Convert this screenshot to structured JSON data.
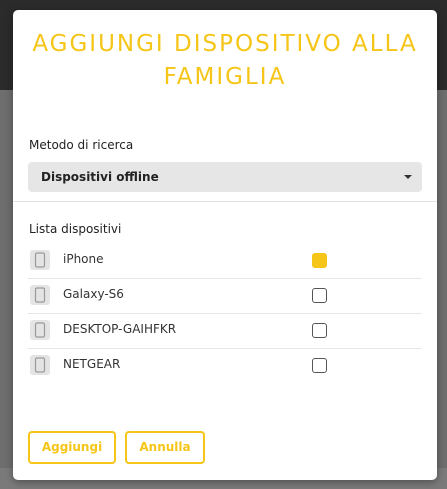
{
  "dialog": {
    "title_line1": "AGGIUNGI DISPOSITIVO ALLA",
    "title_line2": "FAMIGLIA",
    "accent_color": "#f5c518"
  },
  "search": {
    "label": "Metodo di ricerca",
    "selected": "Dispositivi offline"
  },
  "devices": {
    "label": "Lista dispositivi",
    "items": [
      {
        "name": "iPhone",
        "checked": true,
        "icon": "phone-icon"
      },
      {
        "name": "Galaxy-S6",
        "checked": false,
        "icon": "phone-icon"
      },
      {
        "name": "DESKTOP-GAIHFKR",
        "checked": false,
        "icon": "phone-icon"
      },
      {
        "name": "NETGEAR",
        "checked": false,
        "icon": "phone-icon"
      }
    ]
  },
  "actions": {
    "add_label": "Aggiungi",
    "cancel_label": "Annulla"
  }
}
